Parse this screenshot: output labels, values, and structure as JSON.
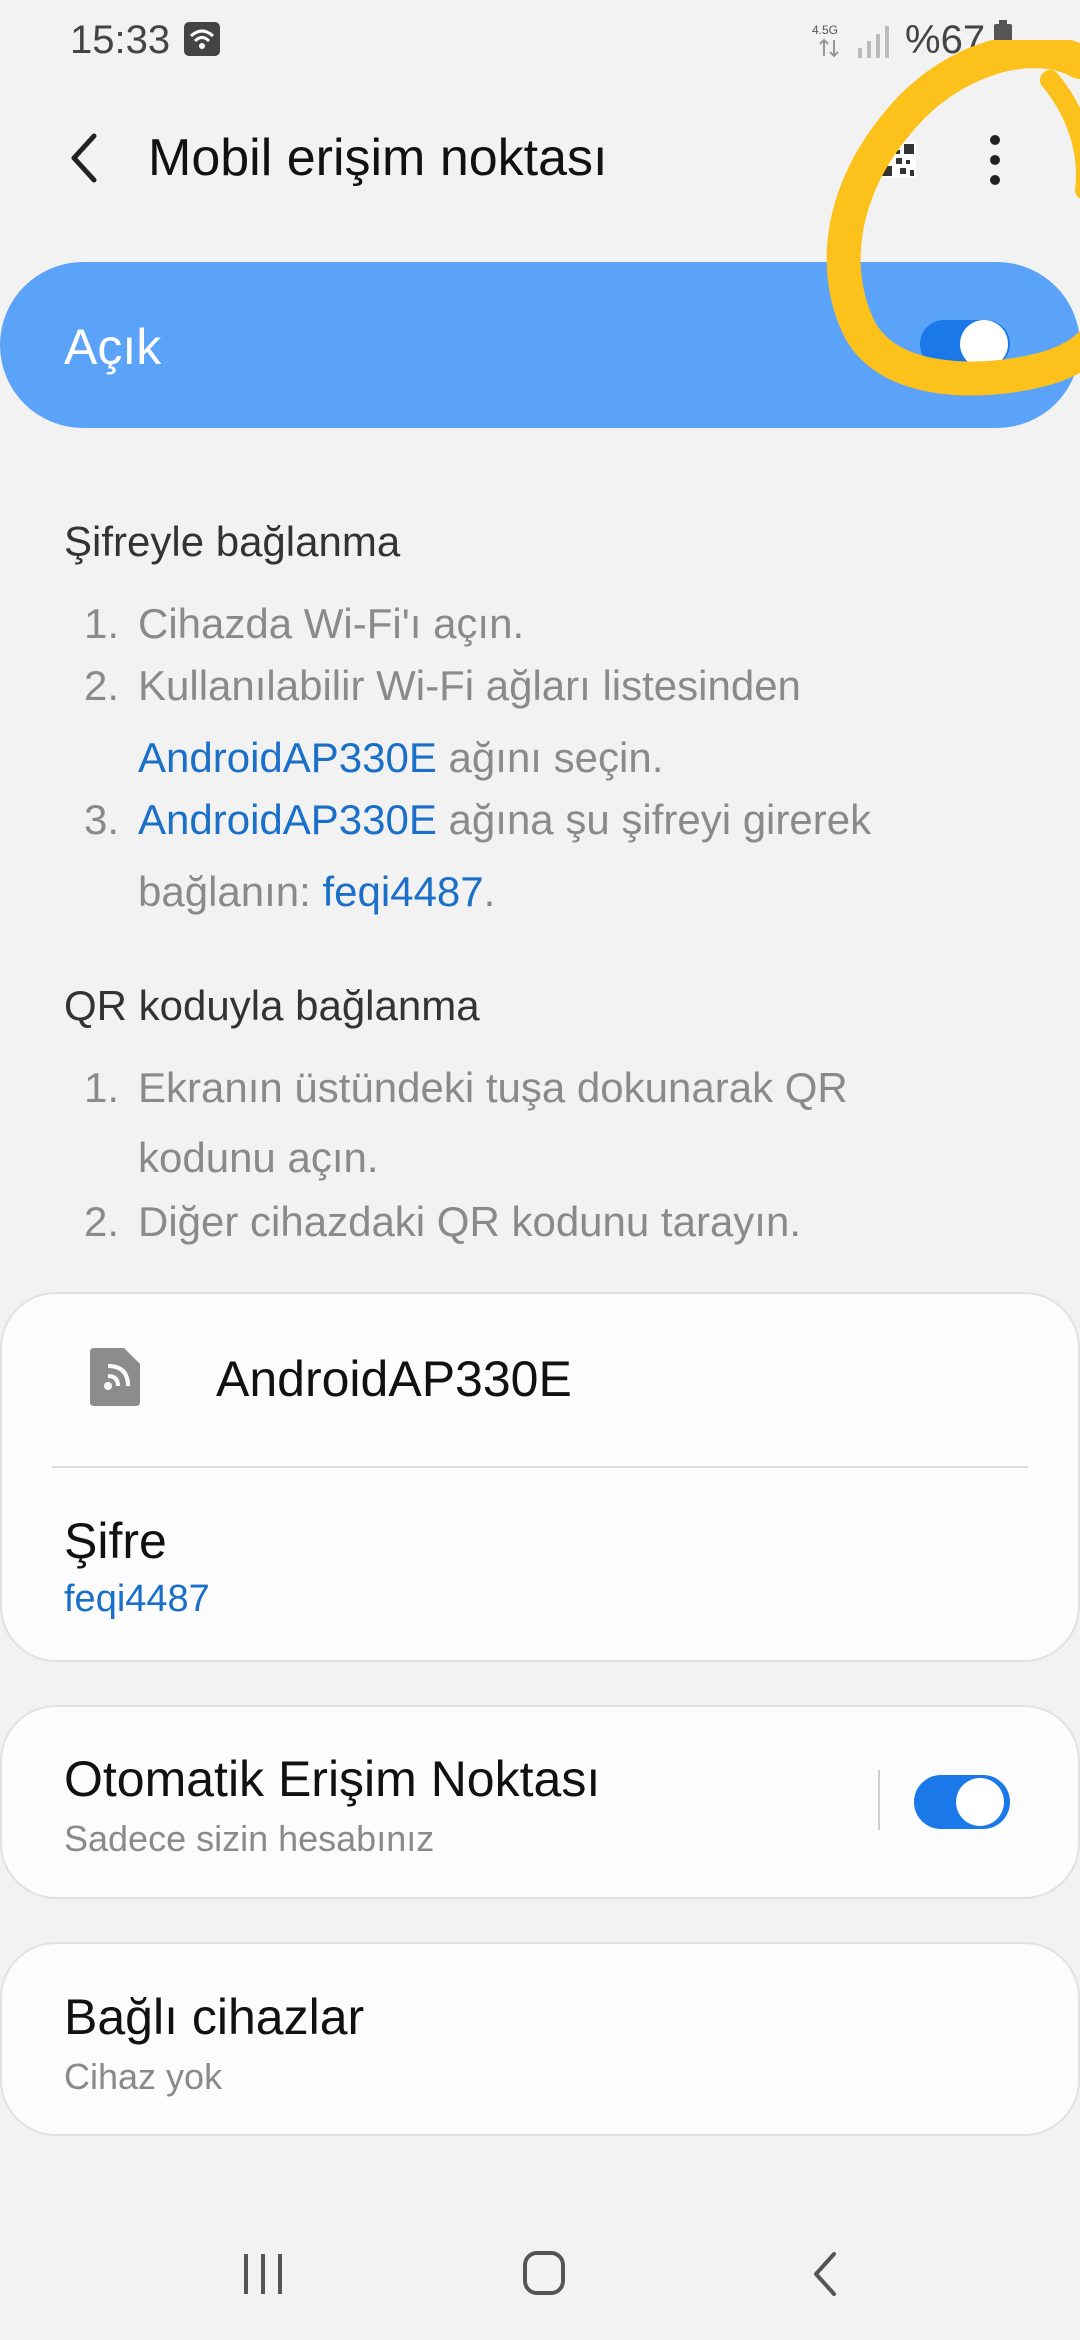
{
  "status_bar": {
    "time": "15:33",
    "network_type": "4.5G",
    "battery": "%67"
  },
  "header": {
    "title": "Mobil erişim noktası"
  },
  "master_toggle": {
    "label": "Açık",
    "state": true
  },
  "password_section": {
    "title": "Şifreyle bağlanma",
    "steps": [
      {
        "num": "1.",
        "text": "Cihazda Wi-Fi'ı açın."
      },
      {
        "num": "2.",
        "line1": "Kullanılabilir Wi-Fi ağları listesinden",
        "link": "AndroidAP330E",
        "line2_rest": " ağını seçin."
      },
      {
        "num": "3.",
        "link": "AndroidAP330E",
        "line1_rest": " ağına şu şifreyi girerek",
        "line2_prefix": "bağlanın: ",
        "password": "feqi4487",
        "line2_suffix": "."
      }
    ]
  },
  "qr_section": {
    "title": "QR koduyla bağlanma",
    "steps": [
      {
        "num": "1.",
        "line1": "Ekranın üstündeki tuşa dokunarak QR",
        "line2": "kodunu açın."
      },
      {
        "num": "2.",
        "text": "Diğer cihazdaki QR kodunu tarayın."
      }
    ]
  },
  "network_card": {
    "name": "AndroidAP330E",
    "password_label": "Şifre",
    "password_value": "feqi4487"
  },
  "auto_hotspot": {
    "title": "Otomatik Erişim Noktası",
    "subtitle": "Sadece sizin hesabınız",
    "state": true
  },
  "connected_devices": {
    "title": "Bağlı cihazlar",
    "subtitle": "Cihaz yok"
  },
  "colors": {
    "accent": "#1b78e8",
    "master_bar": "#5aa3f9",
    "link": "#1a6fc9",
    "highlight": "#fcc21b",
    "background": "#f2f2f2"
  }
}
